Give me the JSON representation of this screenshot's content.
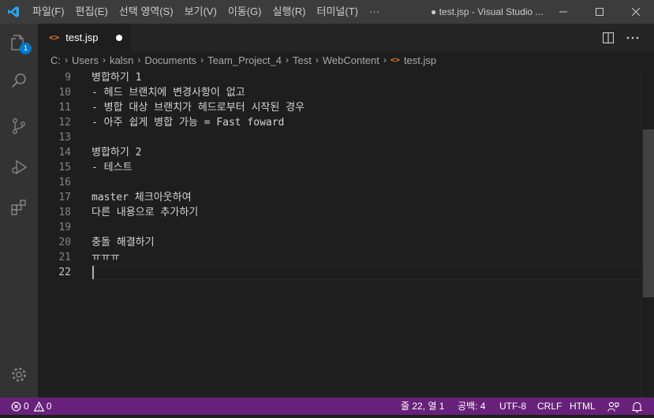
{
  "colors": {
    "titlebar": "#3c3c3c",
    "activitybar": "#333333",
    "editor": "#1e1e1e",
    "statusbar": "#68217a",
    "accent": "#007acc"
  },
  "titlebar": {
    "menu": [
      "파일(F)",
      "편집(E)",
      "선택 영역(S)",
      "보기(V)",
      "이동(G)",
      "실행(R)",
      "터미널(T)",
      "···"
    ],
    "title": "● test.jsp - Visual Studio ...",
    "icons": [
      "vscode-logo-icon",
      "minimize-icon",
      "maximize-icon",
      "close-icon"
    ]
  },
  "activitybar": {
    "items": [
      "explorer-icon",
      "search-icon",
      "source-control-icon",
      "run-debug-icon",
      "extensions-icon",
      "settings-gear-icon"
    ],
    "explorer_badge": "1"
  },
  "tab": {
    "label": "test.jsp",
    "icon": "<>",
    "dirty": true
  },
  "editor_actions": [
    "split-editor-icon",
    "more-actions-icon"
  ],
  "breadcrumb": {
    "items": [
      "C:",
      "Users",
      "kalsn",
      "Documents",
      "Team_Project_4",
      "Test",
      "WebContent"
    ],
    "file": "test.jsp"
  },
  "editor": {
    "lines": [
      {
        "n": "9",
        "text": "병합하기 1"
      },
      {
        "n": "10",
        "text": "- 헤드 브랜치에 변경사항이 없고"
      },
      {
        "n": "11",
        "text": "- 병합 대상 브랜치가 헤드로부터 시작된 경우"
      },
      {
        "n": "12",
        "text": "- 아주 쉽게 병합 가능 = Fast foward"
      },
      {
        "n": "13",
        "text": ""
      },
      {
        "n": "14",
        "text": "병합하기 2"
      },
      {
        "n": "15",
        "text": "- 테스트"
      },
      {
        "n": "16",
        "text": ""
      },
      {
        "n": "17",
        "text": "master 체크아웃하여"
      },
      {
        "n": "18",
        "text": "다른 내용으로 추가하기"
      },
      {
        "n": "19",
        "text": ""
      },
      {
        "n": "20",
        "text": "충돌 해결하기"
      },
      {
        "n": "21",
        "text": "ㅠㅠㅠ"
      },
      {
        "n": "22",
        "text": ""
      }
    ],
    "active_line": "22"
  },
  "statusbar": {
    "errors": "0",
    "warnings": "0",
    "position": "줄 22, 열 1",
    "indent": "공백: 4",
    "encoding": "UTF-8",
    "eol": "CRLF",
    "language": "HTML"
  }
}
